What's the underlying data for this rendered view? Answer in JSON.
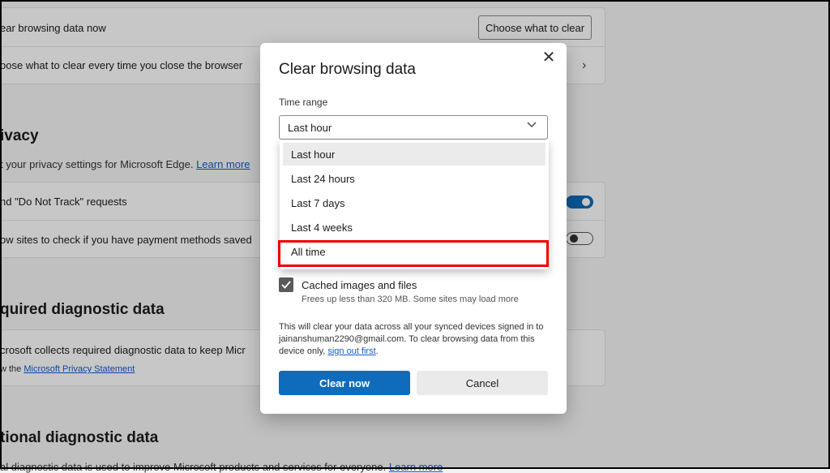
{
  "background": {
    "clear_now_row": "ear browsing data now",
    "choose_button": "Choose what to clear",
    "choose_every_time_row": "oose what to clear every time you close the browser",
    "privacy_title": "ivacy",
    "privacy_desc": "t your privacy settings for Microsoft Edge.",
    "privacy_learn_more": "Learn more",
    "do_not_track_row": "nd \"Do Not Track\" requests",
    "payment_methods_row": "ow sites to check if you have payment methods saved",
    "required_title": "quired diagnostic data",
    "required_desc": "crosoft collects required diagnostic data to keep Micr",
    "privacy_statement_prefix": "w the",
    "privacy_statement_link": "Microsoft Privacy Statement",
    "optional_title": "tional diagnostic data",
    "optional_desc": "al diagnostic data is used to improve Microsoft products and services for everyone.",
    "optional_learn_more": "Learn more"
  },
  "dialog": {
    "title": "Clear browsing data",
    "time_range_label": "Time range",
    "selected_range": "Last hour",
    "options": [
      "Last hour",
      "Last 24 hours",
      "Last 7 days",
      "Last 4 weeks",
      "All time"
    ],
    "cached_label": "Cached images and files",
    "cached_desc": "Frees up less than 320 MB. Some sites may load more",
    "info_text": "This will clear your data across all your synced devices signed in to jainanshuman2290@gmail.com. To clear browsing data from this device only,",
    "sign_out_link": "sign out first",
    "info_end": ".",
    "clear_button": "Clear now",
    "cancel_button": "Cancel"
  }
}
